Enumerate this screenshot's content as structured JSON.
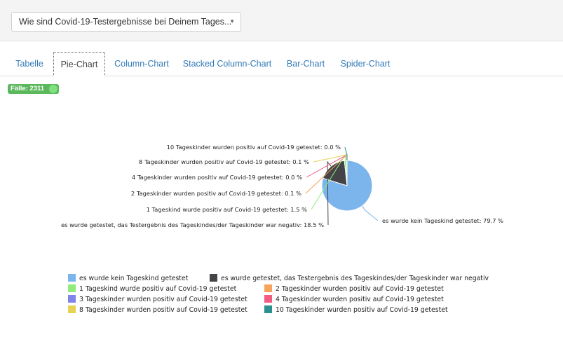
{
  "select": {
    "value": "Wie sind Covid-19-Testergebnisse bei Deinem Tages...",
    "icon": "dropdown-caret-icon"
  },
  "tabs": [
    {
      "label": "Tabelle",
      "active": false
    },
    {
      "label": "Pie-Chart",
      "active": true
    },
    {
      "label": "Column-Chart",
      "active": false
    },
    {
      "label": "Stacked Column-Chart",
      "active": false
    },
    {
      "label": "Bar-Chart",
      "active": false
    },
    {
      "label": "Spider-Chart",
      "active": false
    }
  ],
  "badge": {
    "text": "Fälle: 2311",
    "color": "#5cb85c"
  },
  "chart_data": {
    "type": "pie",
    "title": "",
    "legend_position": "bottom",
    "slices": [
      {
        "name": "es wurde kein Tageskind getestet",
        "value": 79.7,
        "label": "es wurde kein Tageskind getestet: 79.7 %",
        "color": "#7cb5ec"
      },
      {
        "name": "es wurde getestet, das Testergebnis des Tageskindes/der Tageskinder war negativ",
        "value": 18.5,
        "label": "es wurde getestet, das Testergebnis des Tageskindes/der Tageskinder war negativ: 18.5 %",
        "color": "#434348"
      },
      {
        "name": "1 Tageskind wurde positiv auf Covid-19 getestet",
        "value": 1.5,
        "label": "1 Tageskind wurde positiv auf Covid-19 getestet: 1.5 %",
        "color": "#90ed7d"
      },
      {
        "name": "2 Tageskinder wurden positiv auf Covid-19 getestet",
        "value": 0.1,
        "label": "2 Tageskinder wurden positiv auf Covid-19 getestet: 0.1 %",
        "color": "#f7a35c"
      },
      {
        "name": "3 Tageskinder wurden positiv auf Covid-19 getestet",
        "value": 0.0,
        "label": "",
        "color": "#8085e9"
      },
      {
        "name": "4 Tageskinder wurden positiv auf Covid-19 getestet",
        "value": 0.0,
        "label": "4 Tageskinder wurden positiv auf Covid-19 getestet: 0.0 %",
        "color": "#f15c80"
      },
      {
        "name": "8 Tageskinder wurden positiv auf Covid-19 getestet",
        "value": 0.1,
        "label": "8 Tageskinder wurden positiv auf Covid-19 getestet: 0.1 %",
        "color": "#e4d354"
      },
      {
        "name": "10 Tageskinder wurden positiv auf Covid-19 getestet",
        "value": 0.0,
        "label": "10 Tageskinder wurden positiv auf Covid-19 getestet: 0.0 %",
        "color": "#2b908f"
      }
    ]
  }
}
